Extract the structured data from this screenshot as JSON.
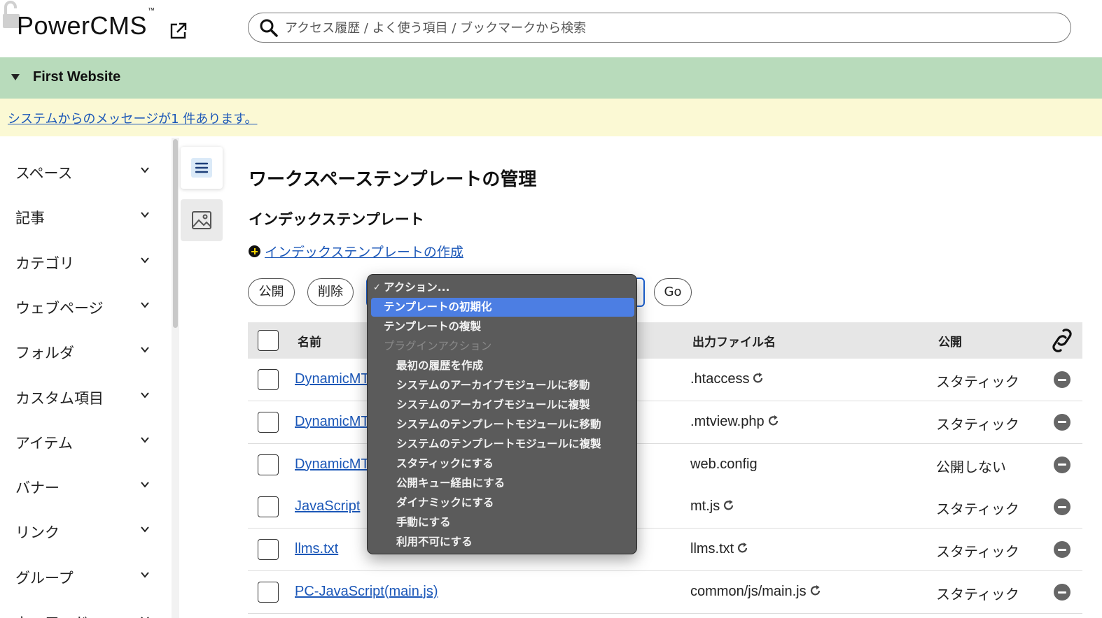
{
  "header": {
    "logo": "PowerCMS",
    "logo_tm": "™",
    "search_placeholder": "アクセス履歴 / よく使う項目 / ブックマークから検索"
  },
  "site": {
    "name": "First Website"
  },
  "message": {
    "text": "システムからのメッセージが1 件あります。"
  },
  "sidebar": {
    "items": [
      {
        "label": "スペース"
      },
      {
        "label": "記事"
      },
      {
        "label": "カテゴリ"
      },
      {
        "label": "ウェブページ"
      },
      {
        "label": "フォルダ"
      },
      {
        "label": "カスタム項目"
      },
      {
        "label": "アイテム"
      },
      {
        "label": "バナー"
      },
      {
        "label": "リンク"
      },
      {
        "label": "グループ"
      },
      {
        "label": "キーワード"
      }
    ]
  },
  "main": {
    "title": "ワークスペーステンプレートの管理",
    "section": "インデックステンプレート",
    "create_link": "インデックステンプレートの作成",
    "publish_label": "公開",
    "delete_label": "削除",
    "go_label": "Go"
  },
  "table": {
    "headers": {
      "name": "名前",
      "file": "出力ファイル名",
      "publish": "公開"
    },
    "rows": [
      {
        "name": "DynamicMTML (.htaccess)",
        "file": ".htaccess",
        "publish": "スタティック",
        "has_refresh": true
      },
      {
        "name": "DynamicMTML (mtview.php)",
        "file": ".mtview.php",
        "publish": "スタティック",
        "has_refresh": true
      },
      {
        "name": "DynamicMTML (web.config)",
        "file": "web.config",
        "publish": "公開しない",
        "has_refresh": false
      },
      {
        "name": "JavaScript",
        "file": "mt.js",
        "publish": "スタティック",
        "has_refresh": true
      },
      {
        "name": "llms.txt",
        "file": "llms.txt",
        "publish": "スタティック",
        "has_refresh": true
      },
      {
        "name": "PC-JavaScript(main.js)",
        "file": "common/js/main.js",
        "publish": "スタティック",
        "has_refresh": true
      }
    ]
  },
  "dropdown": {
    "checkmark": "✓",
    "items": [
      {
        "label": "アクション...",
        "checked": true
      },
      {
        "label": "テンプレートの初期化",
        "selected": true
      },
      {
        "label": "テンプレートの複製"
      },
      {
        "label": "プラグインアクション",
        "disabled": true
      },
      {
        "label": "最初の履歴を作成",
        "indent": true
      },
      {
        "label": "システムのアーカイブモジュールに移動",
        "indent": true
      },
      {
        "label": "システムのアーカイブモジュールに複製",
        "indent": true
      },
      {
        "label": "システムのテンプレートモジュールに移動",
        "indent": true
      },
      {
        "label": "システムのテンプレートモジュールに複製",
        "indent": true
      },
      {
        "label": "スタティックにする",
        "indent": true
      },
      {
        "label": "公開キュー経由にする",
        "indent": true
      },
      {
        "label": "ダイナミックにする",
        "indent": true
      },
      {
        "label": "手動にする",
        "indent": true
      },
      {
        "label": "利用不可にする",
        "indent": true
      }
    ]
  },
  "colors": {
    "site_bar": "#b8dbbb",
    "message_bar": "#fbf9d4",
    "link": "#1b57b8",
    "dropdown_bg": "#5b5b5b",
    "dropdown_selected": "#4c7ee3"
  }
}
